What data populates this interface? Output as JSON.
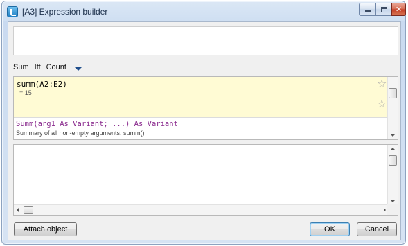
{
  "window": {
    "title": "[A3] Expression builder",
    "minimize_label": "",
    "maximize_label": "",
    "close_label": "✕"
  },
  "expression_input": {
    "value": ""
  },
  "function_bar": {
    "items": [
      "Sum",
      "Iff",
      "Count"
    ]
  },
  "suggestions": {
    "selected": {
      "formula": "summ(A2:E2)",
      "result": "= 15"
    },
    "signature": "Summ(arg1 As Variant; ...) As Variant",
    "description": "Summary of all non-empty arguments. summ()"
  },
  "buttons": {
    "attach": "Attach object",
    "ok": "OK",
    "cancel": "Cancel"
  },
  "colors": {
    "selected_row_bg": "#fffbd4",
    "signature_color": "#8a2b8e"
  }
}
